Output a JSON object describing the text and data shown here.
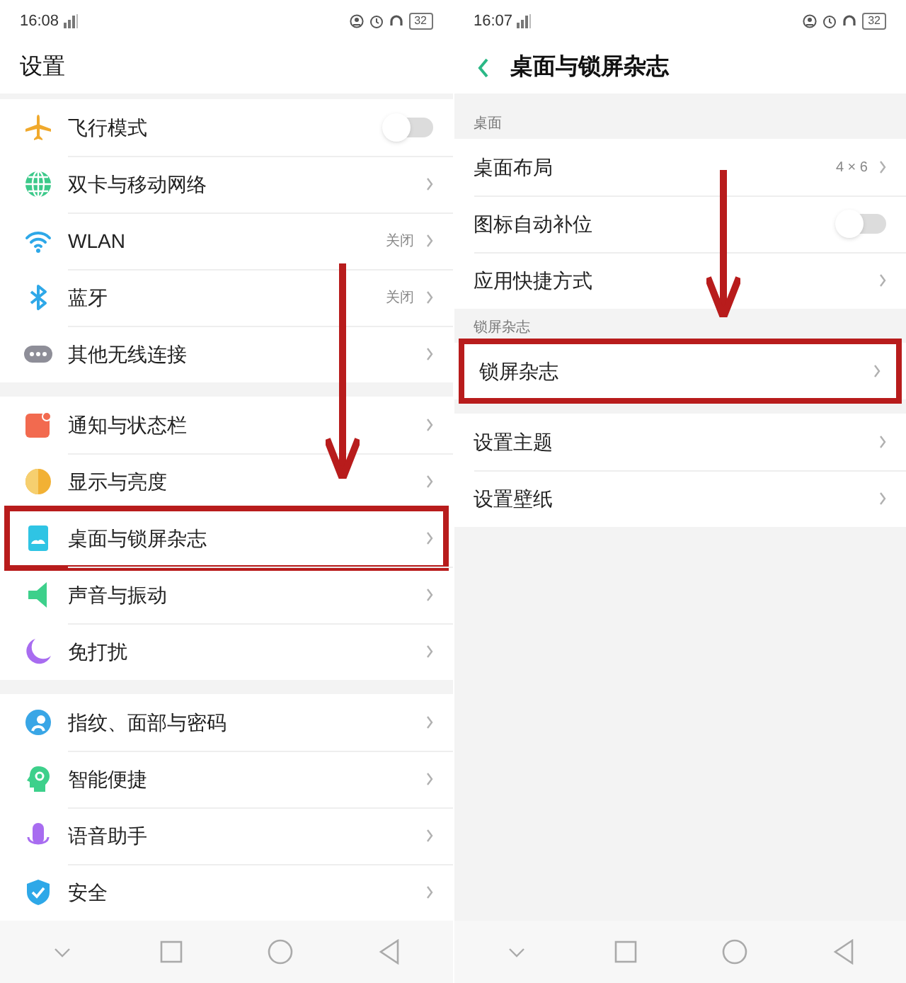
{
  "panels": [
    {
      "status_bar": {
        "time": "16:08",
        "battery": "32"
      },
      "header": {
        "title": "设置"
      },
      "groups": [
        {
          "items": [
            {
              "kind": "toggle",
              "label": "飞行模式",
              "on": false
            },
            {
              "kind": "link",
              "label": "双卡与移动网络"
            },
            {
              "kind": "link",
              "label": "WLAN",
              "value": "关闭"
            },
            {
              "kind": "link",
              "label": "蓝牙",
              "value": "关闭"
            },
            {
              "kind": "link",
              "label": "其他无线连接"
            }
          ]
        },
        {
          "items": [
            {
              "kind": "link",
              "label": "通知与状态栏"
            },
            {
              "kind": "link",
              "label": "显示与亮度"
            },
            {
              "kind": "link",
              "label": "桌面与锁屏杂志",
              "highlighted": true
            },
            {
              "kind": "link",
              "label": "声音与振动"
            },
            {
              "kind": "link",
              "label": "免打扰"
            }
          ]
        },
        {
          "items": [
            {
              "kind": "link",
              "label": "指纹、面部与密码"
            },
            {
              "kind": "link",
              "label": "智能便捷"
            },
            {
              "kind": "link",
              "label": "语音助手"
            },
            {
              "kind": "link",
              "label": "安全"
            }
          ]
        }
      ]
    },
    {
      "status_bar": {
        "time": "16:07",
        "battery": "32"
      },
      "header": {
        "title": "桌面与锁屏杂志",
        "back": true
      },
      "groups": [
        {
          "heading": "桌面",
          "items": [
            {
              "kind": "link",
              "label": "桌面布局",
              "value": "4 × 6"
            },
            {
              "kind": "toggle",
              "label": "图标自动补位",
              "on": false
            },
            {
              "kind": "link",
              "label": "应用快捷方式"
            }
          ]
        },
        {
          "heading": "锁屏杂志",
          "items": [
            {
              "kind": "link",
              "label": "锁屏杂志",
              "highlighted": true
            }
          ]
        },
        {
          "items": [
            {
              "kind": "link",
              "label": "设置主题"
            },
            {
              "kind": "link",
              "label": "设置壁纸"
            }
          ]
        }
      ]
    }
  ]
}
